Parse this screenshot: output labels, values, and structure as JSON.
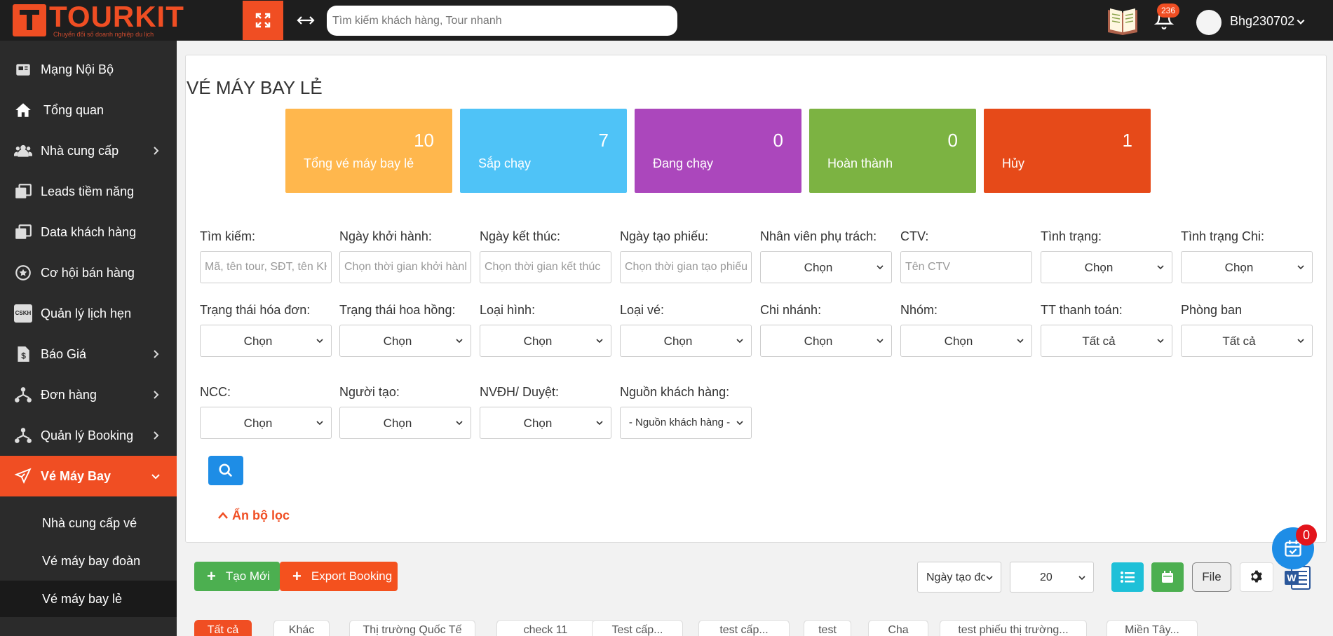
{
  "app": {
    "logo_text": "TOURKIT",
    "logo_tagline": "Chuyển đổi số doanh nghiệp du lịch",
    "search_placeholder": "Tìm kiếm khách hàng, Tour nhanh",
    "notification_count": "236",
    "user_name": "Bhg230702"
  },
  "colors": {
    "brand": "#f04e23",
    "topbar": "#1e1e1e",
    "sidebar": "#2b2b2b",
    "blue": "#1e8de6",
    "green": "#4caf50"
  },
  "sidebar": {
    "items": [
      {
        "label": "Mạng Nội Bộ",
        "icon": "newspaper-icon"
      },
      {
        "label": "Tổng quan",
        "icon": "home-icon"
      },
      {
        "label": "Nhà cung cấp",
        "icon": "users-icon"
      },
      {
        "label": "Leads tiềm năng",
        "icon": "copy-icon"
      },
      {
        "label": "Data khách hàng",
        "icon": "copy-icon"
      },
      {
        "label": "Cơ hội bán hàng",
        "icon": "star-clock-icon"
      },
      {
        "label": "Quản lý lịch hẹn",
        "icon": "cskh-icon",
        "icon_text": "CSKH"
      },
      {
        "label": "Báo Giá",
        "icon": "dollar-doc-icon"
      },
      {
        "label": "Đơn hàng",
        "icon": "network-icon"
      },
      {
        "label": "Quản lý Booking",
        "icon": "network-icon"
      },
      {
        "label": "Vé Máy Bay",
        "icon": "plane-icon"
      }
    ],
    "sub_items": [
      {
        "label": "Nhà cung cấp vé"
      },
      {
        "label": "Vé máy bay đoàn"
      },
      {
        "label": "Vé máy bay lẻ"
      }
    ]
  },
  "page": {
    "title": "VÉ MÁY BAY LẺ"
  },
  "stats": [
    {
      "label": "Tổng vé máy bay lẻ",
      "value": "10",
      "color": "#ffb74d"
    },
    {
      "label": "Sắp chạy",
      "value": "7",
      "color": "#4fc3f7"
    },
    {
      "label": "Đang chạy",
      "value": "0",
      "color": "#ab47bc"
    },
    {
      "label": "Hoàn thành",
      "value": "0",
      "color": "#7cb342"
    },
    {
      "label": "Hủy",
      "value": "1",
      "color": "#e64a19"
    }
  ],
  "filters": {
    "search": {
      "label": "Tìm kiếm:",
      "placeholder": "Mã, tên tour, SĐT, tên KH"
    },
    "departure_date": {
      "label": "Ngày khởi hành:",
      "placeholder": "Chọn thời gian khởi hành"
    },
    "end_date": {
      "label": "Ngày kết thúc:",
      "placeholder": "Chọn thời gian kết thúc"
    },
    "created_date": {
      "label": "Ngày tạo phiếu:",
      "placeholder": "Chọn thời gian tạo phiếu"
    },
    "staff": {
      "label": "Nhân viên phụ trách:",
      "value": "Chọn"
    },
    "ctv": {
      "label": "CTV:",
      "placeholder": "Tên CTV"
    },
    "status": {
      "label": "Tình trạng:",
      "value": "Chọn"
    },
    "expense_status": {
      "label": "Tình trạng Chi:",
      "value": "Chọn"
    },
    "invoice_status": {
      "label": "Trạng thái hóa đơn:",
      "value": "Chọn"
    },
    "commission_status": {
      "label": "Trạng thái hoa hồng:",
      "value": "Chọn"
    },
    "type": {
      "label": "Loại hình:",
      "value": "Chọn"
    },
    "ticket_type": {
      "label": "Loại vé:",
      "value": "Chọn"
    },
    "branch": {
      "label": "Chi nhánh:",
      "value": "Chọn"
    },
    "group": {
      "label": "Nhóm:",
      "value": "Chọn"
    },
    "payment_status": {
      "label": "TT thanh toán:",
      "value": "Tất cả"
    },
    "department": {
      "label": "Phòng ban",
      "value": "Tất cả"
    },
    "supplier": {
      "label": "NCC:",
      "value": "Chọn"
    },
    "creator": {
      "label": "Người tạo:",
      "value": "Chọn"
    },
    "operator": {
      "label": "NVĐH/ Duyệt:",
      "value": "Chọn"
    },
    "customer_source": {
      "label": "Nguồn khách hàng:",
      "value": "- Nguồn khách hàng -"
    }
  },
  "actions": {
    "hide_filter": "Ẩn bộ lọc",
    "create_new": "Tạo Mới",
    "export_booking": "Export Booking",
    "sort_select": "Ngày tạo đơn",
    "page_size": "20",
    "file_label": "File",
    "task_badge": "0"
  },
  "tabs": [
    {
      "label": "Tất cả",
      "active": true
    },
    {
      "label": "Khác"
    },
    {
      "label": "Thị trường Quốc Tế"
    },
    {
      "label": "check 11"
    },
    {
      "label": "Test cấp..."
    },
    {
      "label": "test cấp..."
    },
    {
      "label": "test"
    },
    {
      "label": "Cha"
    },
    {
      "label": "test phiếu thị trường..."
    },
    {
      "label": "Miền Tây..."
    }
  ]
}
